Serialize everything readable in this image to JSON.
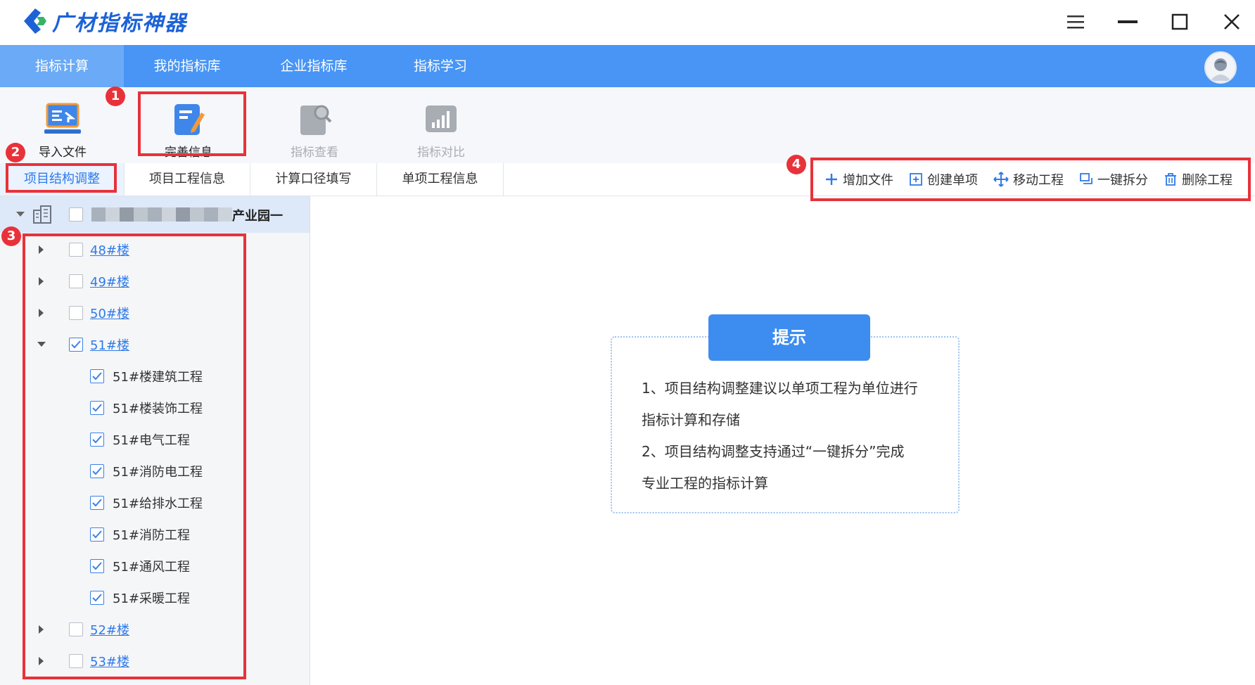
{
  "app": {
    "title": "广材指标神器"
  },
  "nav": {
    "tabs": [
      "指标计算",
      "我的指标库",
      "企业指标库",
      "指标学习"
    ]
  },
  "toolbar": {
    "import": "导入文件",
    "complete": "完善信息",
    "view": "指标查看",
    "compare": "指标对比"
  },
  "subtabs": [
    "项目结构调整",
    "项目工程信息",
    "计算口径填写",
    "单项工程信息"
  ],
  "actions": {
    "add_file": "增加文件",
    "create_item": "创建单项",
    "move": "移动工程",
    "split": "一键拆分",
    "delete": "删除工程"
  },
  "tree": {
    "root_label": "产业园一",
    "nodes": [
      "48#楼",
      "49#楼",
      "50#楼",
      "51#楼",
      "52#楼",
      "53#楼"
    ],
    "children_51": [
      "51#楼建筑工程",
      "51#楼装饰工程",
      "51#电气工程",
      "51#消防电工程",
      "51#给排水工程",
      "51#消防工程",
      "51#通风工程",
      "51#采暖工程"
    ]
  },
  "hint": {
    "title": "提示",
    "line1": "1、项目结构调整建议以单项工程为单位进行",
    "line2": "指标计算和存储",
    "line3": "2、项目结构调整支持通过“一键拆分”完成",
    "line4": "专业工程的指标计算"
  },
  "badges": [
    "1",
    "2",
    "3",
    "4"
  ],
  "colors": {
    "nav_bg": "#4895f5",
    "accent": "#2f7ae8",
    "annotation": "#e8323a"
  }
}
